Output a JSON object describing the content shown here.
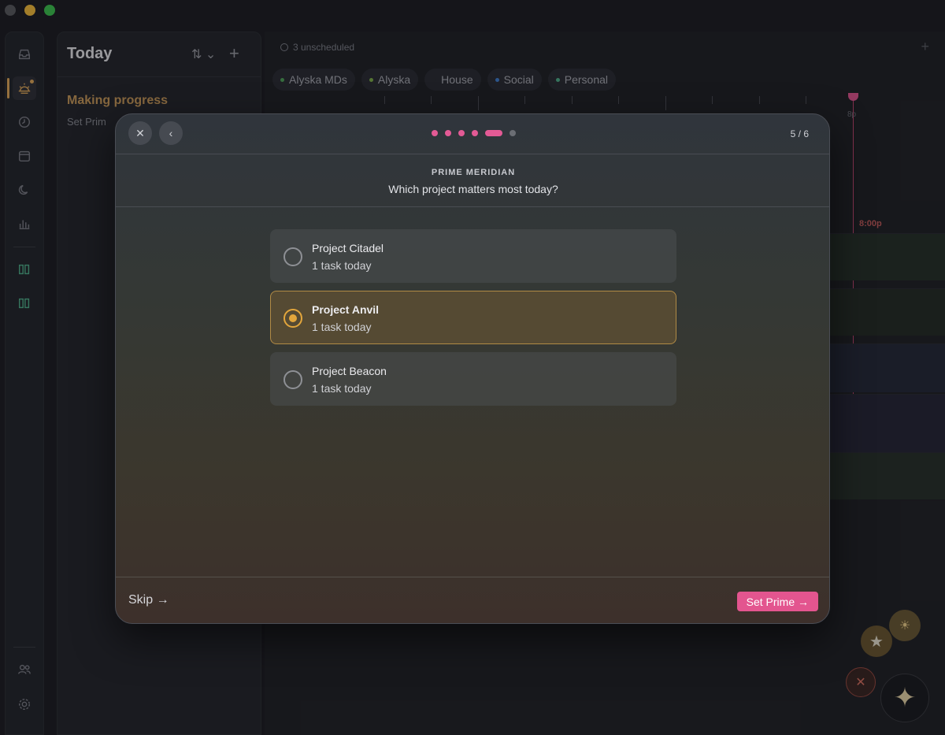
{
  "sidebar": {
    "icons": [
      "inbox-icon",
      "sunrise-icon",
      "clock-icon",
      "calendar-icon",
      "moon-icon",
      "chart-icon",
      "books-icon",
      "books-alt-icon",
      "people-icon",
      "gear-icon"
    ]
  },
  "today": {
    "title": "Today",
    "sort_label": "⇅ ⌄",
    "add_label": "+",
    "section_title": "Making progress",
    "set_prime_label": "Set Prim"
  },
  "calendar": {
    "unscheduled": "3 unscheduled",
    "add_label": "+",
    "chips": [
      {
        "label": "Alyska MDs",
        "color": "#4fa35a"
      },
      {
        "label": "Alyska",
        "color": "#7fb04a"
      },
      {
        "label": "House",
        "color": "#2a2c33"
      },
      {
        "label": "Social",
        "color": "#3f7fd0"
      },
      {
        "label": "Personal",
        "color": "#4fb08a"
      }
    ],
    "hour_label": "8p",
    "time_marker": "8:00p"
  },
  "modal": {
    "close_label": "✕",
    "back_label": "‹",
    "step_current": 5,
    "step_total": 6,
    "step_counter": "5 / 6",
    "eyebrow": "PRIME MERIDIAN",
    "question": "Which project matters most today?",
    "options": [
      {
        "name": "Project Citadel",
        "subtitle": "1 task today",
        "selected": false
      },
      {
        "name": "Project Anvil",
        "subtitle": "1 task today",
        "selected": true
      },
      {
        "name": "Project Beacon",
        "subtitle": "1 task today",
        "selected": false
      }
    ],
    "skip_label": "Skip →",
    "primary_label": "Set Prime →"
  },
  "colors": {
    "accent_pink": "#e3558f",
    "accent_gold": "#e3a63c"
  }
}
